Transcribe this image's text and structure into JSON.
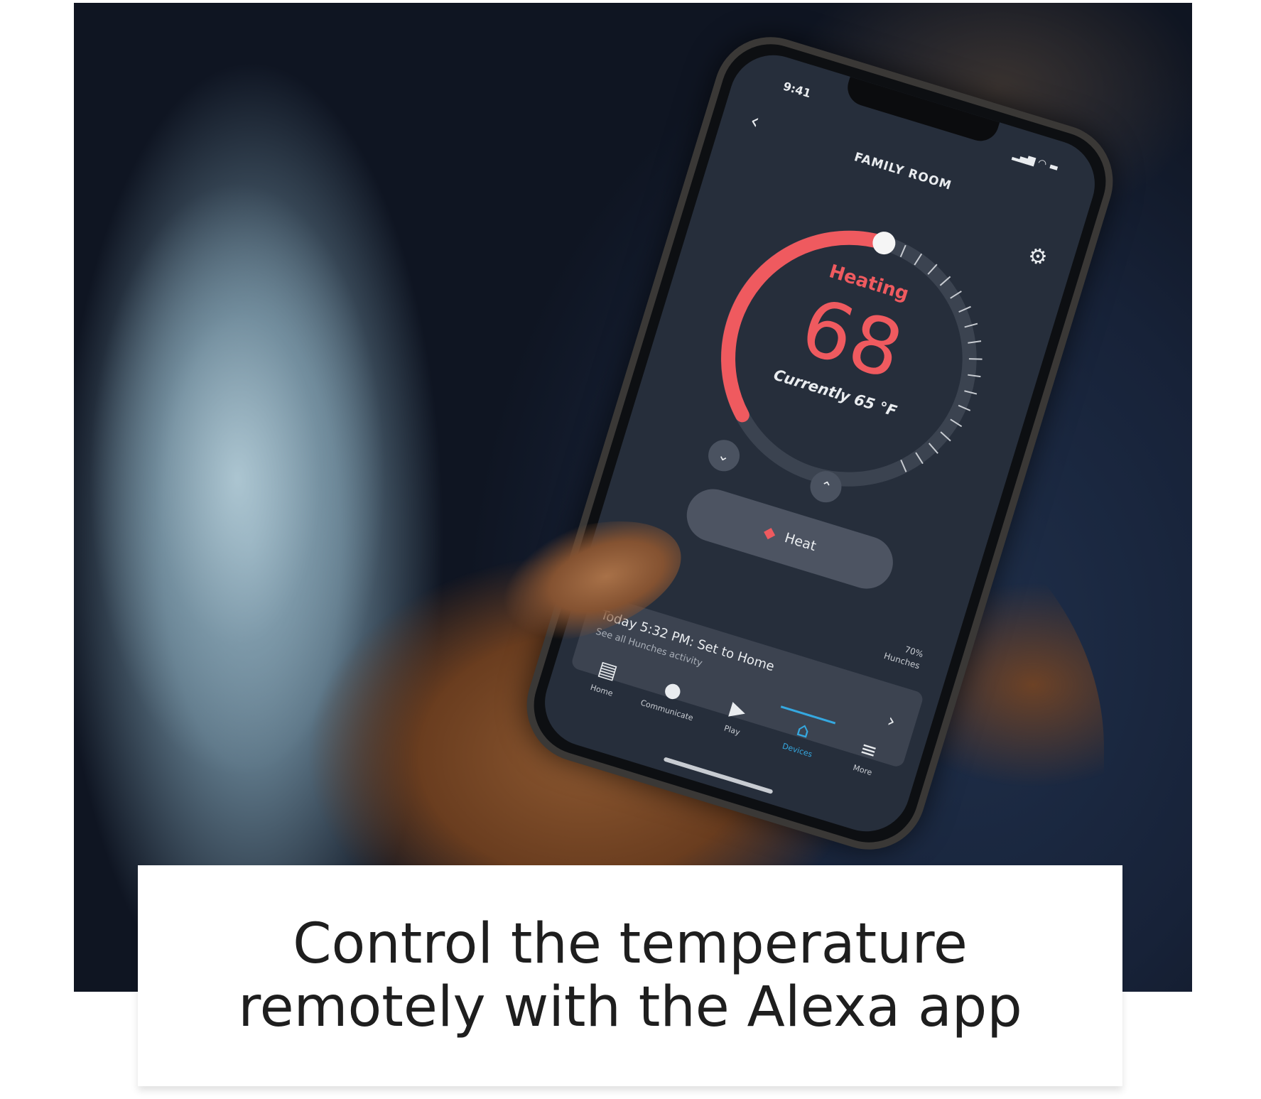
{
  "caption": {
    "line1": "Control the temperature",
    "line2": "remotely with the Alexa app"
  },
  "app": {
    "status_time": "9:41",
    "status_icons": "signal wifi battery",
    "room_title": "FAMILY ROOM",
    "mode_status": "Heating",
    "setpoint": "68",
    "current_temp": "Currently 65 °F",
    "mode_label": "Heat",
    "humidity_value": "70%",
    "humidity_location": "Hunches",
    "activity_title": "Today 5:32 PM: Set to Home",
    "activity_subtitle": "See all Hunches activity",
    "nav": [
      {
        "label": "Home",
        "icon": "home-icon"
      },
      {
        "label": "Communicate",
        "icon": "chat-bubble-icon"
      },
      {
        "label": "Play",
        "icon": "play-icon"
      },
      {
        "label": "Devices",
        "icon": "devices-house-icon"
      },
      {
        "label": "More",
        "icon": "menu-icon"
      }
    ]
  },
  "colors": {
    "accent_heat": "#ef5a5f",
    "accent_active_nav": "#35a8e0",
    "screen_bg": "#262e3b"
  }
}
